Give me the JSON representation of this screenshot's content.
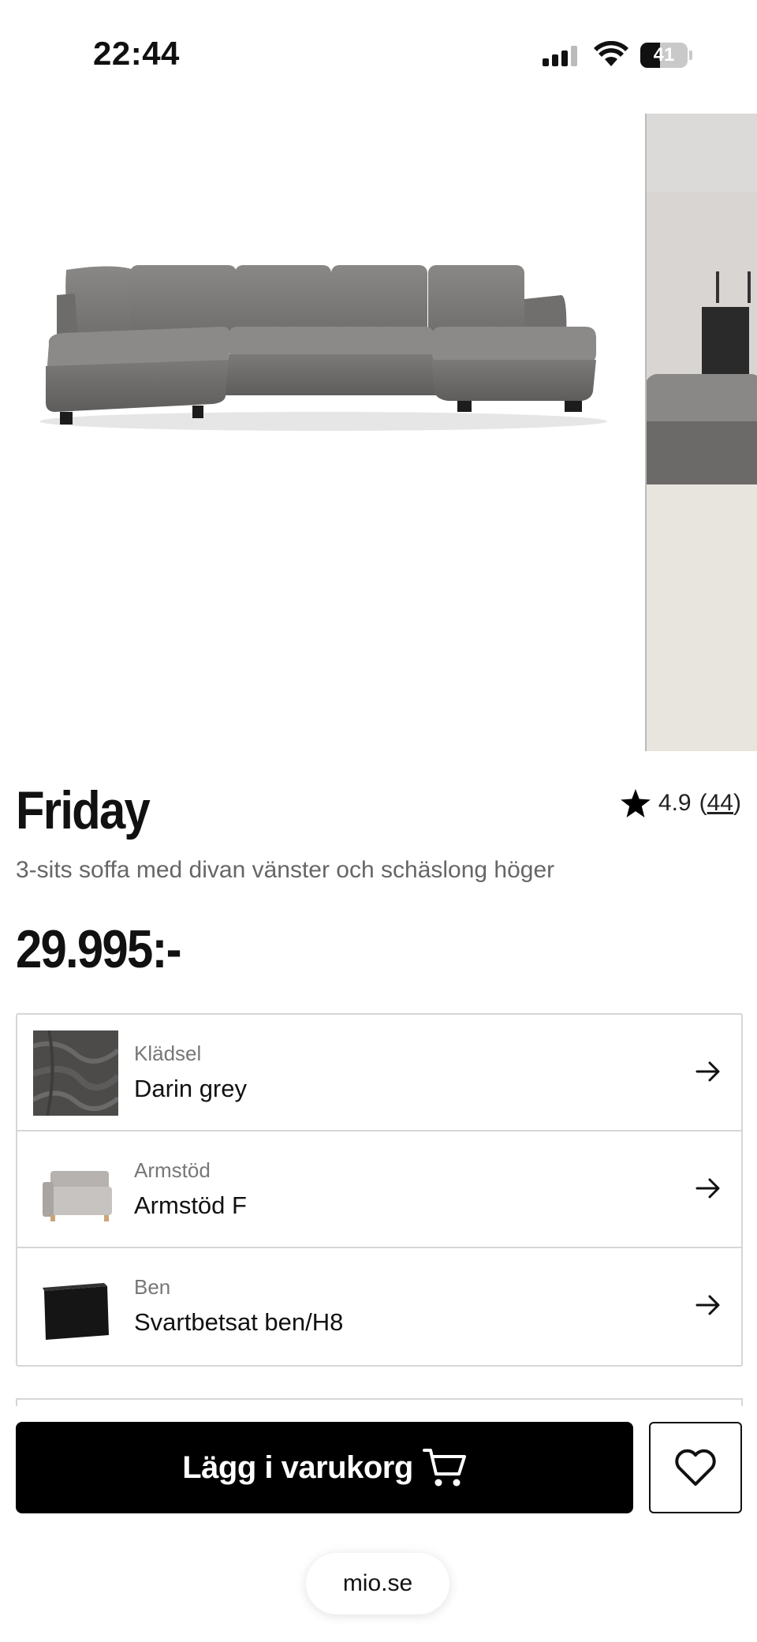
{
  "status_bar": {
    "time": "22:44",
    "battery": "41",
    "battery_level": 0.41
  },
  "product": {
    "name": "Friday",
    "subtitle": "3-sits soffa med divan vänster och schäslong höger",
    "price": "29.995:-",
    "rating": "4.9",
    "review_count": "44"
  },
  "options": [
    {
      "label": "Klädsel",
      "value": "Darin grey",
      "thumb": "fabric-swatch"
    },
    {
      "label": "Armstöd",
      "value": "Armstöd F",
      "thumb": "armchair-thumbnail"
    },
    {
      "label": "Ben",
      "value": "Svartbetsat ben/H8",
      "thumb": "leg-block-thumbnail"
    }
  ],
  "actions": {
    "add_to_cart": "Lägg i varukorg"
  },
  "browser": {
    "url": "mio.se"
  },
  "colors": {
    "primary": "#000000",
    "border": "#d6d6d6",
    "sofa": "#7a7876"
  }
}
